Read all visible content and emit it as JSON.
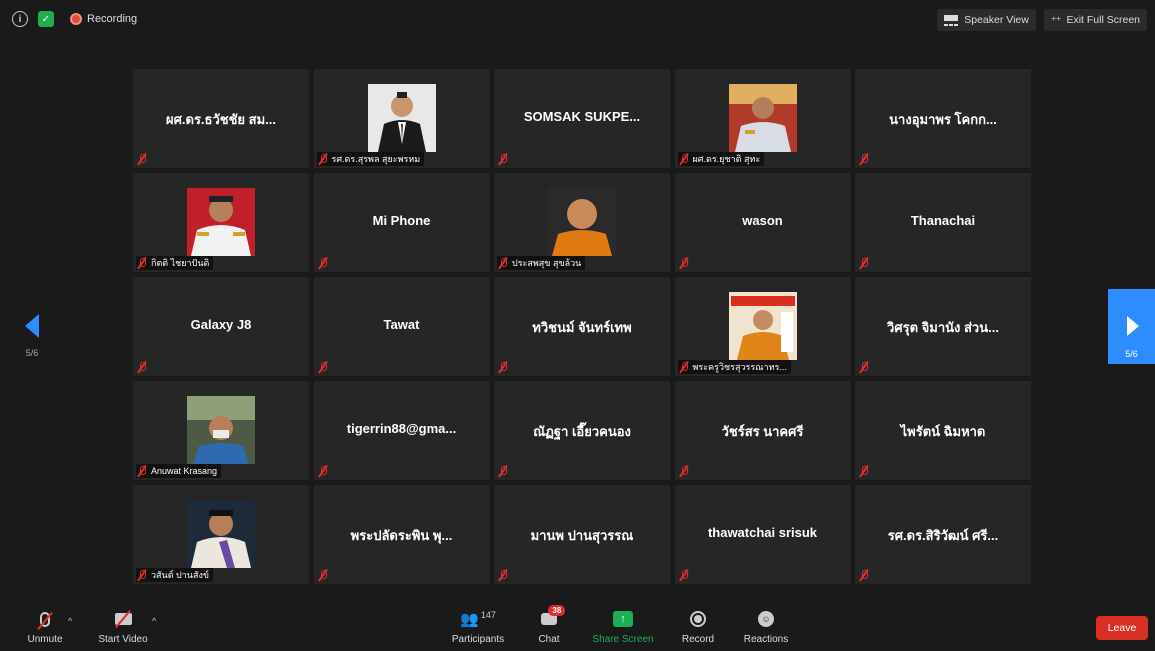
{
  "topbar": {
    "recording_label": "Recording",
    "speaker_view_label": "Speaker View",
    "exit_fullscreen_label": "Exit Full Screen"
  },
  "pagination": {
    "left_count": "5/6",
    "right_count": "5/6"
  },
  "tiles": [
    {
      "name": "ผศ.ดร.ธวัชชัย สม...",
      "label": "",
      "photo": null
    },
    {
      "name": "",
      "label": "รศ.ดร.สุรพล สุยะพรหม",
      "photo": "suit"
    },
    {
      "name": "SOMSAK SUKPE...",
      "label": "",
      "photo": null
    },
    {
      "name": "",
      "label": "ผศ.ดร.ยุชาติ สุทะ",
      "photo": "uniform"
    },
    {
      "name": "นางอุมาพร โคกก...",
      "label": "",
      "photo": null
    },
    {
      "name": "",
      "label": "กิตติ ไชยาปันดิ",
      "photo": "white-uniform"
    },
    {
      "name": "Mi Phone",
      "label": "",
      "photo": null
    },
    {
      "name": "",
      "label": "ประสพสุข สุขล้วน",
      "photo": "monk"
    },
    {
      "name": "wason",
      "label": "",
      "photo": null
    },
    {
      "name": "Thanachai",
      "label": "",
      "photo": null
    },
    {
      "name": "Galaxy J8",
      "label": "",
      "photo": null
    },
    {
      "name": "Tawat",
      "label": "",
      "photo": null
    },
    {
      "name": "ทวิชนม์ จันทร์เทพ",
      "label": "",
      "photo": null
    },
    {
      "name": "",
      "label": "พระครูวิชรสุวรรณาทร...",
      "photo": "monk-stage"
    },
    {
      "name": "วิศรุต จิมานัง ส่วน...",
      "label": "",
      "photo": null
    },
    {
      "name": "",
      "label": "Anuwat Krasang",
      "photo": "selfie"
    },
    {
      "name": "tigerrin88@gma...",
      "label": "",
      "photo": null
    },
    {
      "name": "ณัฏฐา เอี๊ยวคนอง",
      "label": "",
      "photo": null
    },
    {
      "name": "วัชร์สร นาคศรี",
      "label": "",
      "photo": null
    },
    {
      "name": "ไพรัตน์ ฉิมหาด",
      "label": "",
      "photo": null
    },
    {
      "name": "",
      "label": "วสันต์ ปานสังข์",
      "photo": "sash"
    },
    {
      "name": "พระปลัดระพิน พุ...",
      "label": "",
      "photo": null
    },
    {
      "name": "มานพ ปานสุวรรณ",
      "label": "",
      "photo": null
    },
    {
      "name": "thawatchai srisuk",
      "label": "",
      "photo": null
    },
    {
      "name": "รศ.ดร.สิริวัฒน์ ศรี...",
      "label": "",
      "photo": null
    }
  ],
  "toolbar": {
    "unmute_label": "Unmute",
    "start_video_label": "Start Video",
    "participants_label": "Participants",
    "participants_count": "147",
    "chat_label": "Chat",
    "chat_badge": "38",
    "share_screen_label": "Share Screen",
    "record_label": "Record",
    "reactions_label": "Reactions",
    "leave_label": "Leave"
  },
  "colors": {
    "accent": "#2d8cff",
    "share": "#1ab055",
    "leave": "#d93025",
    "muted": "#e02d2d"
  }
}
